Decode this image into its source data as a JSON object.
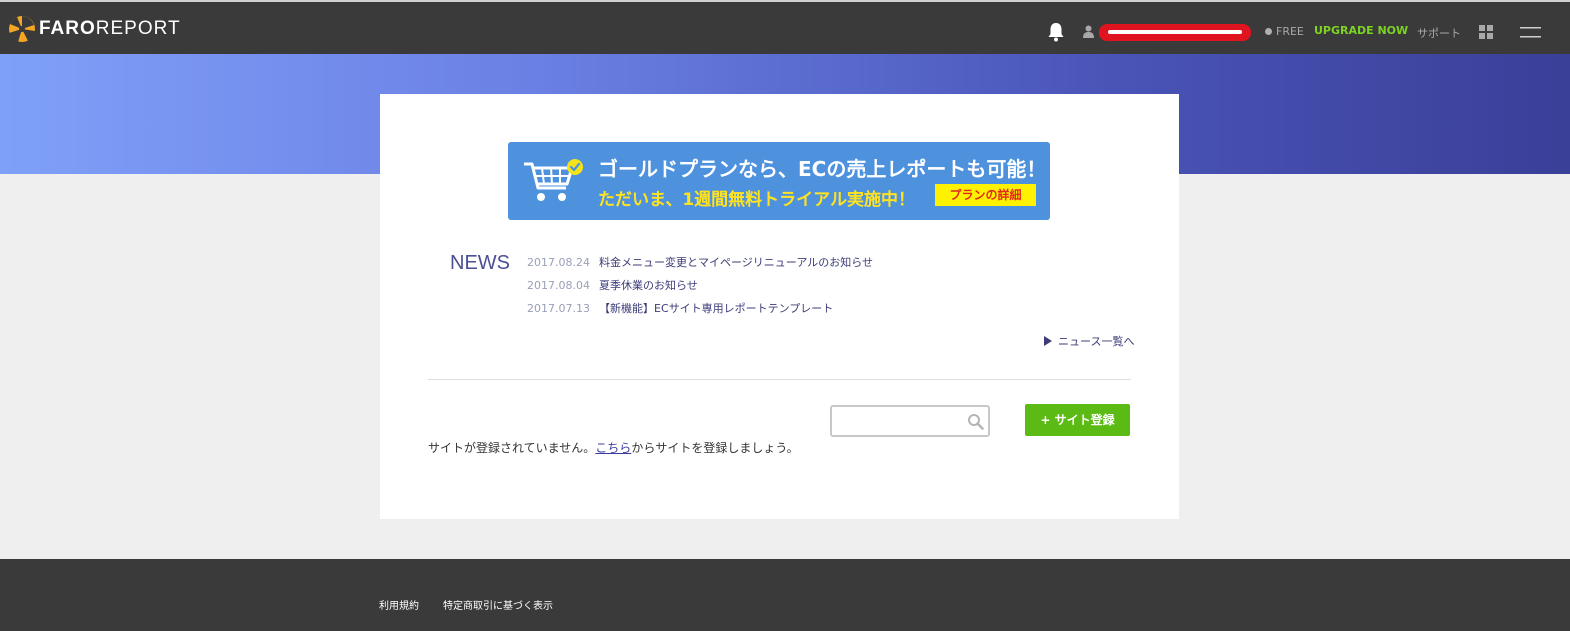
{
  "header": {
    "logo_bold": "FARO",
    "logo_light": "REPORT",
    "plan_label": "FREE",
    "upgrade_label": "UPGRADE NOW",
    "support_label": "サポート",
    "colors": {
      "bar": "#3a3a3a",
      "upgrade": "#7dd322",
      "redaction": "#e0141e"
    },
    "icons": [
      "logo-icon",
      "bell-icon",
      "user-icon",
      "grid-icon",
      "hamburger-menu-icon"
    ]
  },
  "banner": {
    "line1": "ゴールドプランなら、ECの売上レポートも可能！",
    "line2": "ただいま、1週間無料トライアル実施中！",
    "button": "プランの詳細",
    "icon": "shopping-cart-icon"
  },
  "news": {
    "title": "NEWS",
    "items": [
      {
        "date": "2017.08.24",
        "text": "料金メニュー変更とマイページリニューアルのお知らせ"
      },
      {
        "date": "2017.08.04",
        "text": "夏季休業のお知らせ"
      },
      {
        "date": "2017.07.13",
        "text": "【新機能】ECサイト専用レポートテンプレート"
      }
    ],
    "more_label": "ニュース一覧へ"
  },
  "sites": {
    "search_placeholder": "",
    "search_value": "",
    "add_button": "+ サイト登録",
    "empty_prefix": "サイトが登録されていません。",
    "empty_link": "こちら",
    "empty_suffix": "からサイトを登録しましょう。"
  },
  "footer": {
    "links": [
      "利用規約",
      "特定商取引に基づく表示"
    ]
  }
}
